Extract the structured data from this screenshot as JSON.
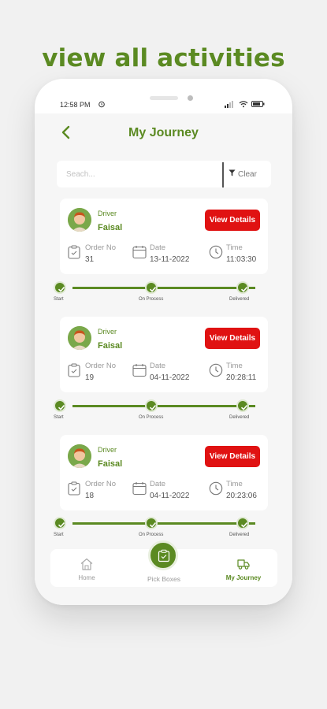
{
  "headline": "view all activities",
  "status_bar": {
    "time": "12:58 PM"
  },
  "header": {
    "title": "My Journey"
  },
  "search": {
    "placeholder": "Seach...",
    "clear_label": "Clear"
  },
  "labels": {
    "driver": "Driver",
    "view_details": "View Details",
    "order_no": "Order No",
    "date": "Date",
    "time": "Time",
    "stage_start": "Start",
    "stage_process": "On Process",
    "stage_delivered": "Delivered"
  },
  "journeys": [
    {
      "driver": "Faisal",
      "order_no": "31",
      "date": "13-11-2022",
      "time": "11:03:30"
    },
    {
      "driver": "Faisal",
      "order_no": "19",
      "date": "04-11-2022",
      "time": "20:28:11"
    },
    {
      "driver": "Faisal",
      "order_no": "18",
      "date": "04-11-2022",
      "time": "20:23:06"
    }
  ],
  "nav": {
    "home": "Home",
    "pick_boxes": "Pick Boxes",
    "my_journey": "My Journey"
  },
  "colors": {
    "accent": "#5b8a22",
    "danger": "#e01212",
    "background": "#f6f6f6"
  },
  "icons": {
    "back": "chevron-left-icon",
    "filter": "funnel-icon",
    "order": "clipboard-icon",
    "date": "calendar-icon",
    "time": "clock-icon",
    "home": "house-icon",
    "pick": "box-icon",
    "journey": "truck-icon"
  }
}
